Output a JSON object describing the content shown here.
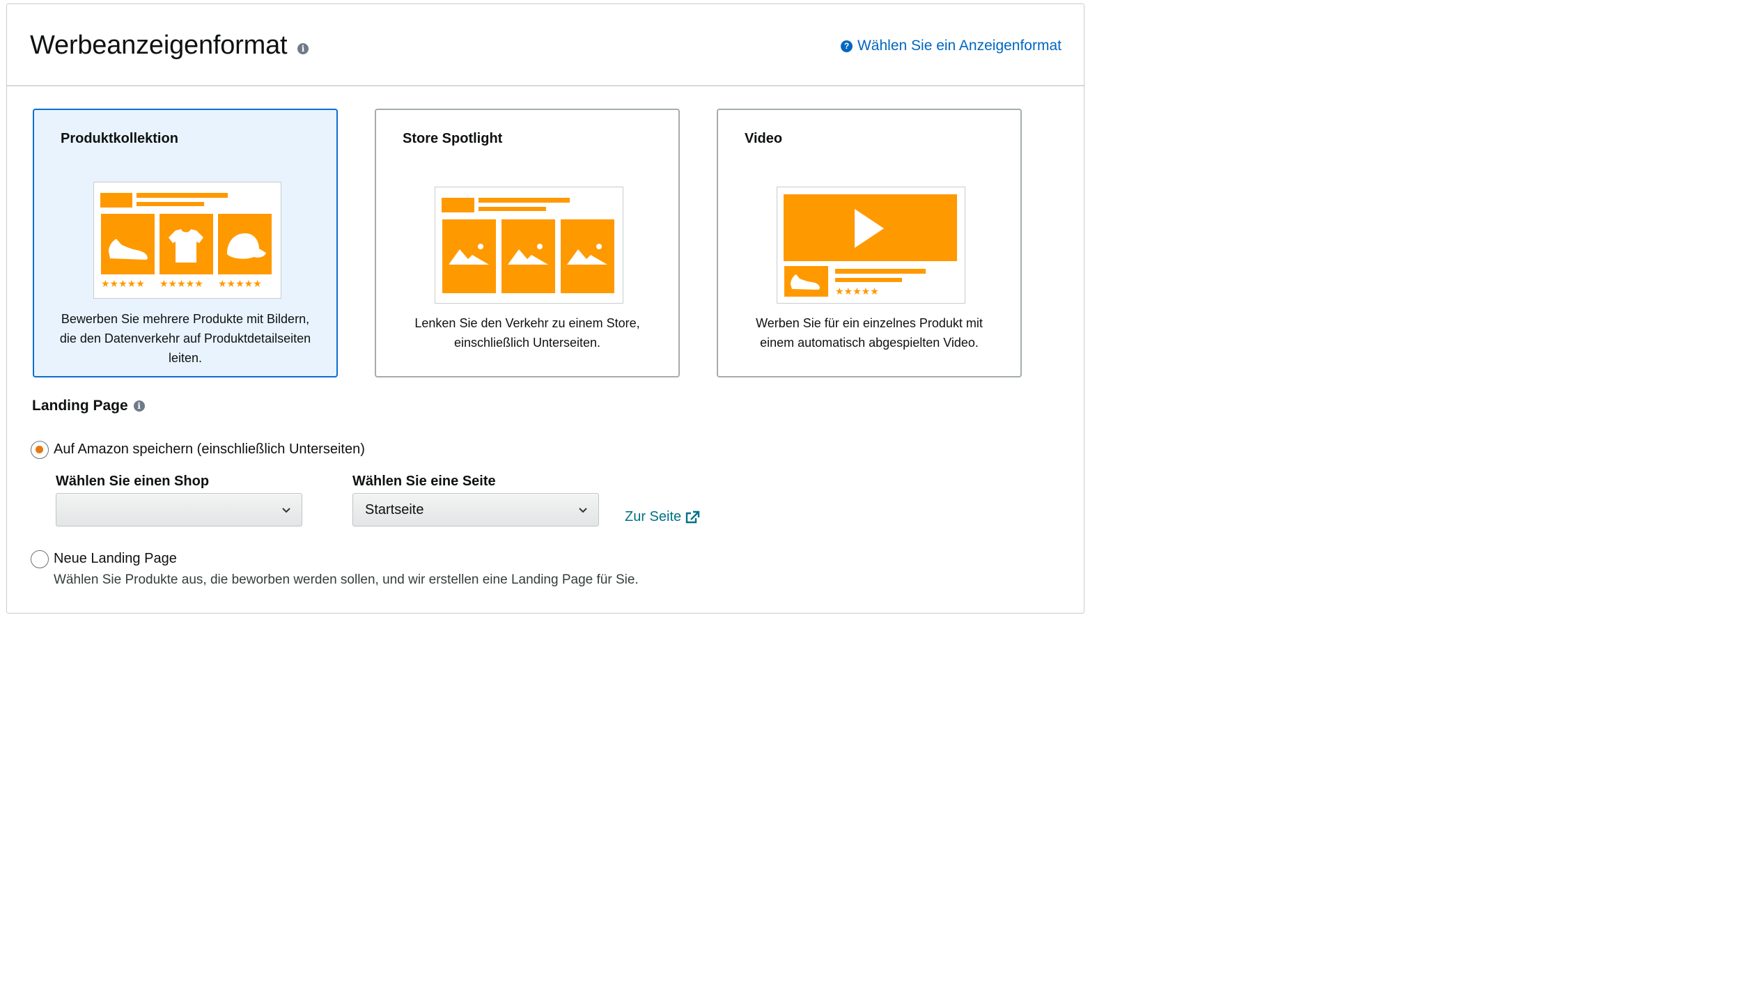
{
  "header": {
    "title": "Werbeanzeigenformat",
    "help_link": "Wählen Sie ein Anzeigenformat"
  },
  "formats": [
    {
      "title": "Produktkollektion",
      "description": "Bewerben Sie mehrere Produkte mit Bildern, die den Datenverkehr auf Produktdetailseiten leiten.",
      "selected": true
    },
    {
      "title": "Store Spotlight",
      "description": "Lenken Sie den Verkehr zu einem Store, einschließlich Unterseiten.",
      "selected": false
    },
    {
      "title": "Video",
      "description": "Werben Sie für ein einzelnes Produkt mit einem automatisch abgespielten Video.",
      "selected": false
    }
  ],
  "landing": {
    "title": "Landing Page",
    "option1_label": "Auf Amazon speichern (einschließlich Unterseiten)",
    "shop_label": "Wählen Sie einen Shop",
    "shop_value": "",
    "page_label": "Wählen Sie eine Seite",
    "page_value": "Startseite",
    "goto_link": "Zur Seite",
    "option2_label": "Neue Landing Page",
    "option2_desc": "Wählen Sie Produkte aus, die beworben werden sollen, und wir erstellen eine Landing Page für Sie."
  },
  "colors": {
    "accent_orange": "#ff9900",
    "link_blue": "#0066c0",
    "link_teal": "#007185",
    "selected_border": "#0a6ed1",
    "selected_bg": "#e8f3fe"
  },
  "icons": [
    "info-icon",
    "question-icon",
    "sneaker-icon",
    "tshirt-icon",
    "cap-icon",
    "star-icon",
    "image-icon",
    "play-icon",
    "chevron-down-icon",
    "external-link-icon"
  ]
}
